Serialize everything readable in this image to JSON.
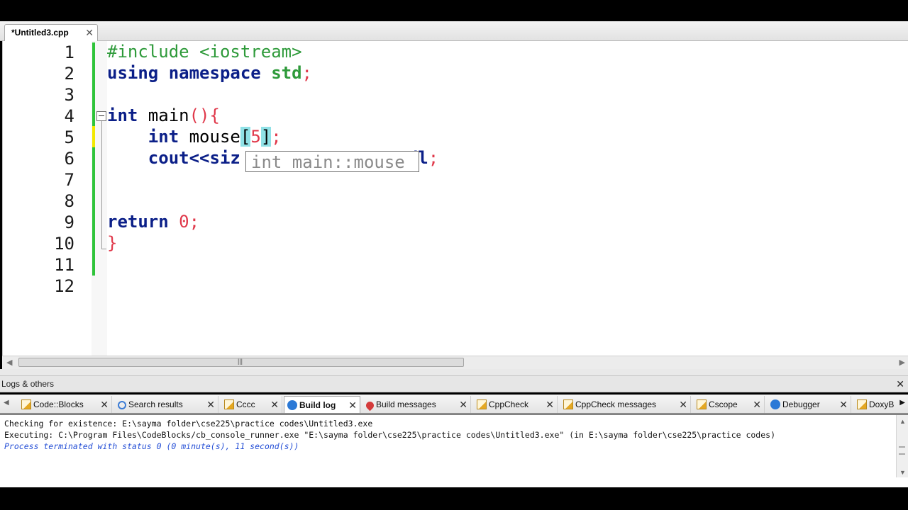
{
  "editor": {
    "tab": {
      "title": "*Untitled3.cpp",
      "close": "✕"
    },
    "line_numbers": [
      "1",
      "2",
      "3",
      "4",
      "5",
      "6",
      "7",
      "8",
      "9",
      "10",
      "11",
      "12"
    ],
    "code": {
      "l1": "#include <iostream>",
      "l2_kw": "using namespace",
      "l2_rest": " std",
      "l2_semi": ";",
      "l4_kw": "int",
      "l4_name": " main",
      "l4_paren": "(){",
      "l5_indent": "    ",
      "l5_kw": "int",
      "l5_name": " mouse",
      "l5_open": "[",
      "l5_num": "5",
      "l5_close": "]",
      "l5_semi": ";",
      "l6_indent": "    ",
      "l6_kw": "cout",
      "l6_op": "<<",
      "l6_visible": "siz",
      "l6_tail": "dl",
      "l6_semi": ";",
      "l9_kw": "return",
      "l9_num": " 0",
      "l9_semi": ";",
      "l10_brace": "}"
    },
    "tooltip": "int main::mouse"
  },
  "logs": {
    "header": "Logs & others",
    "close": "✕",
    "tabs": [
      {
        "label": "Code::Blocks",
        "icon": "note-icon"
      },
      {
        "label": "Search results",
        "icon": "search-icon"
      },
      {
        "label": "Cccc",
        "icon": "note-icon"
      },
      {
        "label": "Build log",
        "icon": "gear-icon",
        "active": true
      },
      {
        "label": "Build messages",
        "icon": "pin-icon"
      },
      {
        "label": "CppCheck",
        "icon": "note-icon"
      },
      {
        "label": "CppCheck messages",
        "icon": "note-icon"
      },
      {
        "label": "Cscope",
        "icon": "note-icon"
      },
      {
        "label": "Debugger",
        "icon": "gear-icon"
      },
      {
        "label": "DoxyB",
        "icon": "note-icon"
      }
    ],
    "lines": [
      "Checking for existence: E:\\sayma folder\\cse225\\practice codes\\Untitled3.exe",
      "Executing: C:\\Program Files\\CodeBlocks/cb_console_runner.exe \"E:\\sayma folder\\cse225\\practice codes\\Untitled3.exe\"  (in E:\\sayma folder\\cse225\\practice codes)",
      "Process terminated with status 0 (0 minute(s), 11 second(s))"
    ]
  },
  "colors": {
    "preprocessor": "#2e9a3a",
    "keyword": "#0b1f88",
    "number": "#e0384a",
    "bracket_highlight": "#8fe1e6",
    "changed_line_bar": "#2fc43a",
    "status_text": "#2650d6"
  }
}
